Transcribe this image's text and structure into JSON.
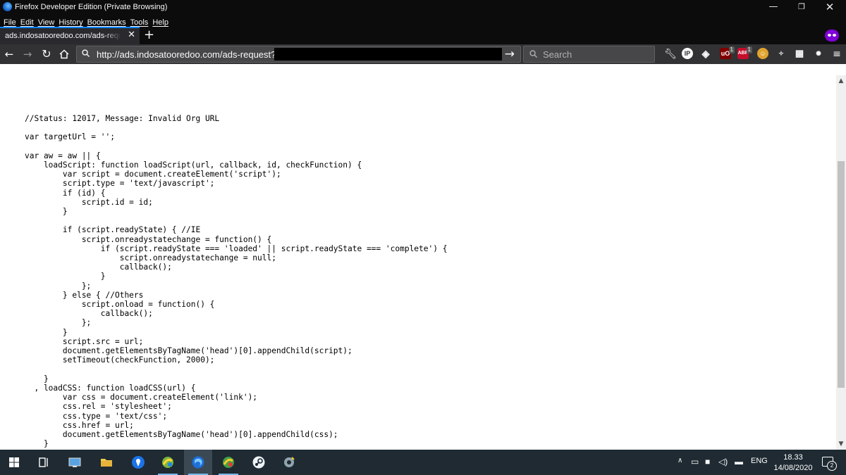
{
  "window": {
    "title": "Firefox Developer Edition (Private Browsing)"
  },
  "menu": [
    "File",
    "Edit",
    "View",
    "History",
    "Bookmarks",
    "Tools",
    "Help"
  ],
  "tab": {
    "title": "ads.indosatooredoo.com/ads-request?j",
    "close": "✕",
    "new_tab": "+"
  },
  "nav": {
    "url": "http://ads.indosatooredoo.com/ads-request?j",
    "go": "→",
    "search_placeholder": "Search"
  },
  "extensions": {
    "ip_label": "IP",
    "ublock_badge": "1",
    "abp_label": "ABP",
    "abp_badge": "1"
  },
  "page": {
    "code": "//Status: 12017, Message: Invalid Org URL\n\nvar targetUrl = '';\n\nvar aw = aw || {\n    loadScript: function loadScript(url, callback, id, checkFunction) {\n        var script = document.createElement('script');\n        script.type = 'text/javascript';\n        if (id) {\n            script.id = id;\n        }\n\n        if (script.readyState) { //IE\n            script.onreadystatechange = function() {\n                if (script.readyState === 'loaded' || script.readyState === 'complete') {\n                    script.onreadystatechange = null;\n                    callback();\n                }\n            };\n        } else { //Others\n            script.onload = function() {\n                callback();\n            };\n        }\n        script.src = url;\n        document.getElementsByTagName('head')[0].appendChild(script);\n        setTimeout(checkFunction, 2000);\n\n    }\n  , loadCSS: function loadCSS(url) {\n        var css = document.createElement('link');\n        css.rel = 'stylesheet';\n        css.type = 'text/css';\n        css.href = url;\n        document.getElementsByTagName('head')[0].appendChild(css);\n    }"
  },
  "taskbar": {
    "language": "ENG",
    "time": "18.33",
    "date": "14/08/2020",
    "notification_count": "2"
  },
  "colors": {
    "firefox_dark": "#0c0c0d",
    "toolbar": "#323234",
    "accent_blue": "#0a84ff",
    "private_purple": "#8000d7",
    "taskbar": "#1f2a32"
  }
}
